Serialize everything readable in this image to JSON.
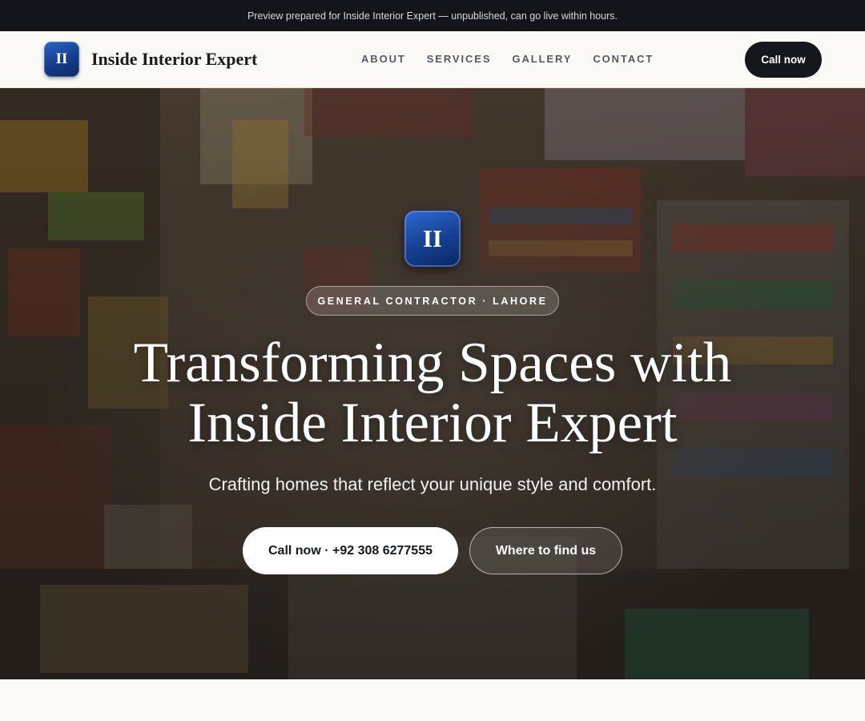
{
  "preview_banner": {
    "text": "Preview prepared for Inside Interior Expert — unpublished, can go live within hours."
  },
  "header": {
    "logo_initials": "II",
    "brand_name": "Inside Interior Expert",
    "nav": [
      {
        "label": "ABOUT"
      },
      {
        "label": "SERVICES"
      },
      {
        "label": "GALLERY"
      },
      {
        "label": "CONTACT"
      }
    ],
    "cta_label": "Call now"
  },
  "hero": {
    "logo_initials": "II",
    "tag": "GENERAL CONTRACTOR · LAHORE",
    "title_line1": "Transforming Spaces with",
    "title_line2": "Inside Interior Expert",
    "subtitle": "Crafting homes that reflect your unique style and comfort.",
    "primary_button": "Call now · +92 308 6277555",
    "secondary_button": "Where to find us"
  },
  "colors": {
    "dark": "#15171c",
    "brand_blue": "#143d8c",
    "page_bg": "#faf9f6"
  }
}
